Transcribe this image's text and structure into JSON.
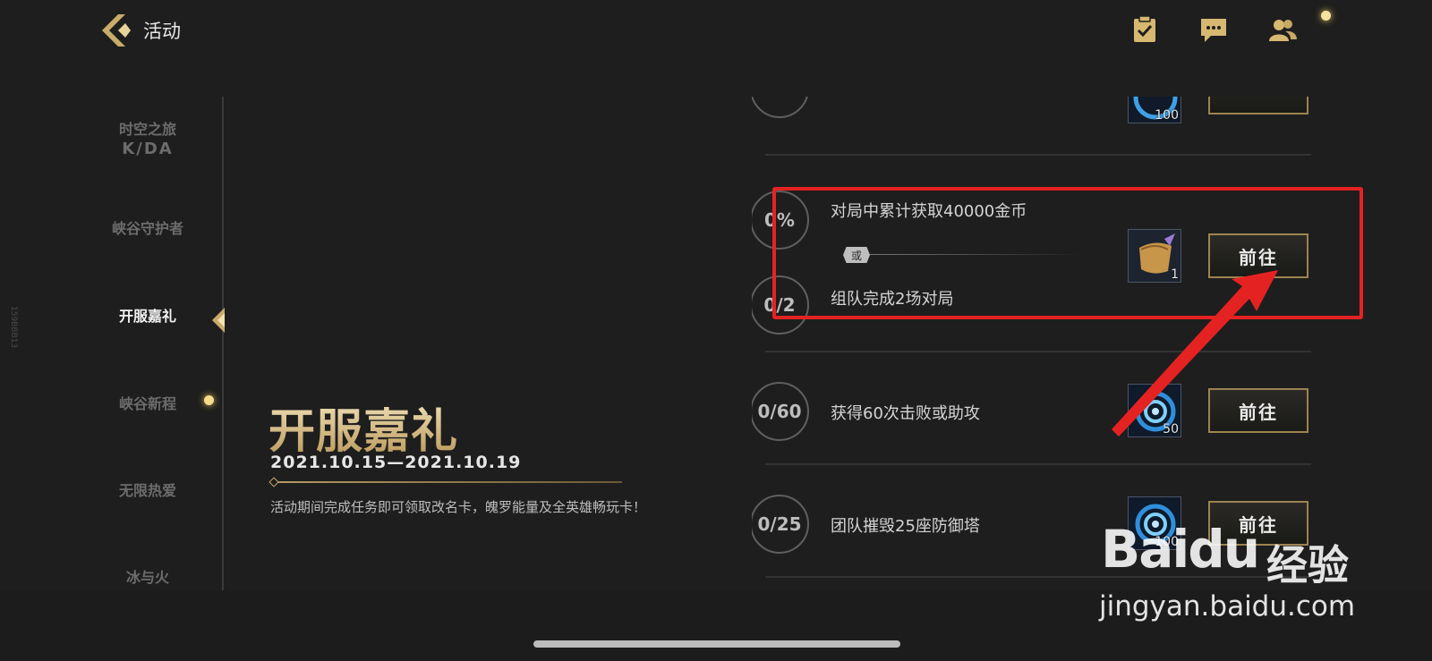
{
  "header": {
    "title": "活动",
    "icons": [
      "task-list-icon",
      "chat-icon",
      "friends-icon"
    ]
  },
  "side_id": "159BBB13",
  "sidebar": {
    "items": [
      {
        "label_line1": "时空之旅",
        "label_line2": "K/DA"
      },
      {
        "label": "峡谷守护者"
      },
      {
        "label": "开服嘉礼",
        "active": true
      },
      {
        "label": "峡谷新程",
        "has_dot": true
      },
      {
        "label": "无限热爱"
      },
      {
        "label": "冰与火"
      }
    ]
  },
  "event": {
    "title": "开服嘉礼",
    "date": "2021.10.15—2021.10.19",
    "description": "活动期间完成任务即可领取改名卡，魄罗能量及全英雄畅玩卡！"
  },
  "tasks": [
    {
      "progress_a": "0%",
      "text_a": "对局中累计获取40000金币",
      "or_label": "或",
      "progress_b": "0/2",
      "text_b": "组队完成2场对局",
      "reward_count": "1",
      "reward_icon": "rename-scroll-icon",
      "button": "前往"
    },
    {
      "progress": "0/60",
      "text": "获得60次击败或助攻",
      "reward_count": "50",
      "reward_icon": "poro-energy-icon",
      "button": "前往"
    },
    {
      "progress": "0/25",
      "text": "团队摧毁25座防御塔",
      "reward_count": "100",
      "reward_icon": "poro-energy-icon",
      "button": "前往"
    }
  ],
  "partial_top_task": {
    "reward_count": "100"
  },
  "watermark": {
    "logo": "Baidu",
    "cn": "经验",
    "url": "jingyan.baidu.com"
  },
  "colors": {
    "accent_gold": "#c9ab6a",
    "annotation_red": "#e52222",
    "background": "#1e1e1e"
  }
}
